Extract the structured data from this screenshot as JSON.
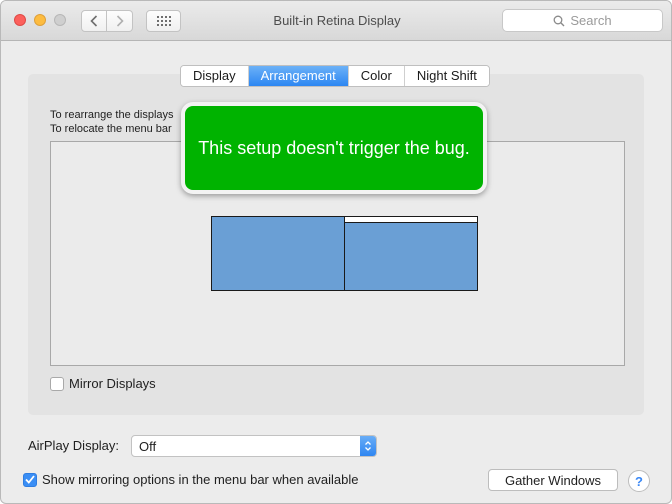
{
  "window": {
    "title": "Built-in Retina Display"
  },
  "toolbar": {
    "back_icon": "chevron-left-icon",
    "forward_icon": "chevron-right-icon",
    "grid_icon": "show-all-grid-icon",
    "search_placeholder": "Search"
  },
  "tabs": [
    {
      "label": "Display",
      "active": false
    },
    {
      "label": "Arrangement",
      "active": true
    },
    {
      "label": "Color",
      "active": false
    },
    {
      "label": "Night Shift",
      "active": false
    }
  ],
  "arrangement": {
    "instruction_line1": "To rearrange the displays",
    "instruction_line2": "To relocate the menu bar",
    "mirror_label": "Mirror Displays",
    "mirror_checked": false
  },
  "callout": {
    "text": "This setup doesn't trigger the bug."
  },
  "airplay": {
    "label": "AirPlay Display:",
    "value": "Off"
  },
  "menubar_option": {
    "label": "Show mirroring options in the menu bar when available",
    "checked": true
  },
  "buttons": {
    "gather": "Gather Windows",
    "help": "?"
  },
  "colors": {
    "accent": "#2c86f2",
    "display_fill": "#6a9fd5",
    "callout_green": "#00b300"
  }
}
